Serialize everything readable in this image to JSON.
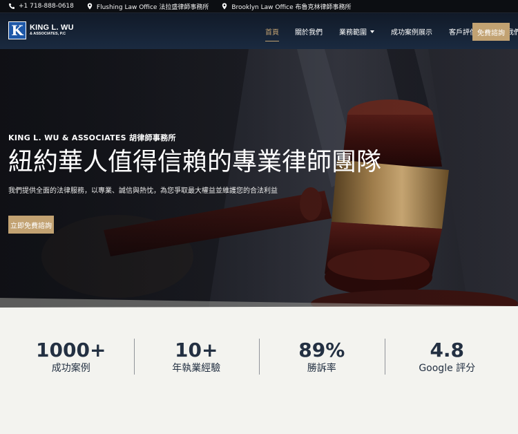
{
  "topbar": {
    "phone": "+1 718-888-0618",
    "flushing": "Flushing Law Office 法拉盛律師事務所",
    "brooklyn": "Brooklyn Law Office 布魯克林律師事務所"
  },
  "logo": {
    "mark": "K",
    "line1": "KING L. WU",
    "line2": "& ASSOCIATES, P.C"
  },
  "nav": {
    "items": [
      {
        "label": "首頁"
      },
      {
        "label": "關於我們"
      },
      {
        "label": "業務範圍"
      },
      {
        "label": "成功案例展示"
      },
      {
        "label": "客戶評價"
      },
      {
        "label": "聯絡我們"
      }
    ],
    "cta": "免費諮詢"
  },
  "hero": {
    "eyebrow": "KING L. WU & ASSOCIATES 胡律師事務所",
    "title": "紐約華人值得信賴的專業律師團隊",
    "subtitle": "我們提供全面的法律服務，以專業、誠信與熱忱，為您爭取最大權益並維護您的合法利益",
    "cta": "立即免費諮詢"
  },
  "stats": [
    {
      "value": "1000+",
      "label": "成功案例"
    },
    {
      "value": "10+",
      "label": "年執業經驗"
    },
    {
      "value": "89%",
      "label": "勝訴率"
    },
    {
      "value": "4.8",
      "label": "Google 評分"
    }
  ],
  "colors": {
    "accent": "#c2a272",
    "navy": "#233042",
    "header_bg": "#14202f",
    "topbar_bg": "#0c0e12",
    "logo_blue": "#1e58a8"
  },
  "icons": {
    "phone": "phone-icon",
    "location": "map-marker-icon",
    "caret": "chevron-down-icon"
  }
}
